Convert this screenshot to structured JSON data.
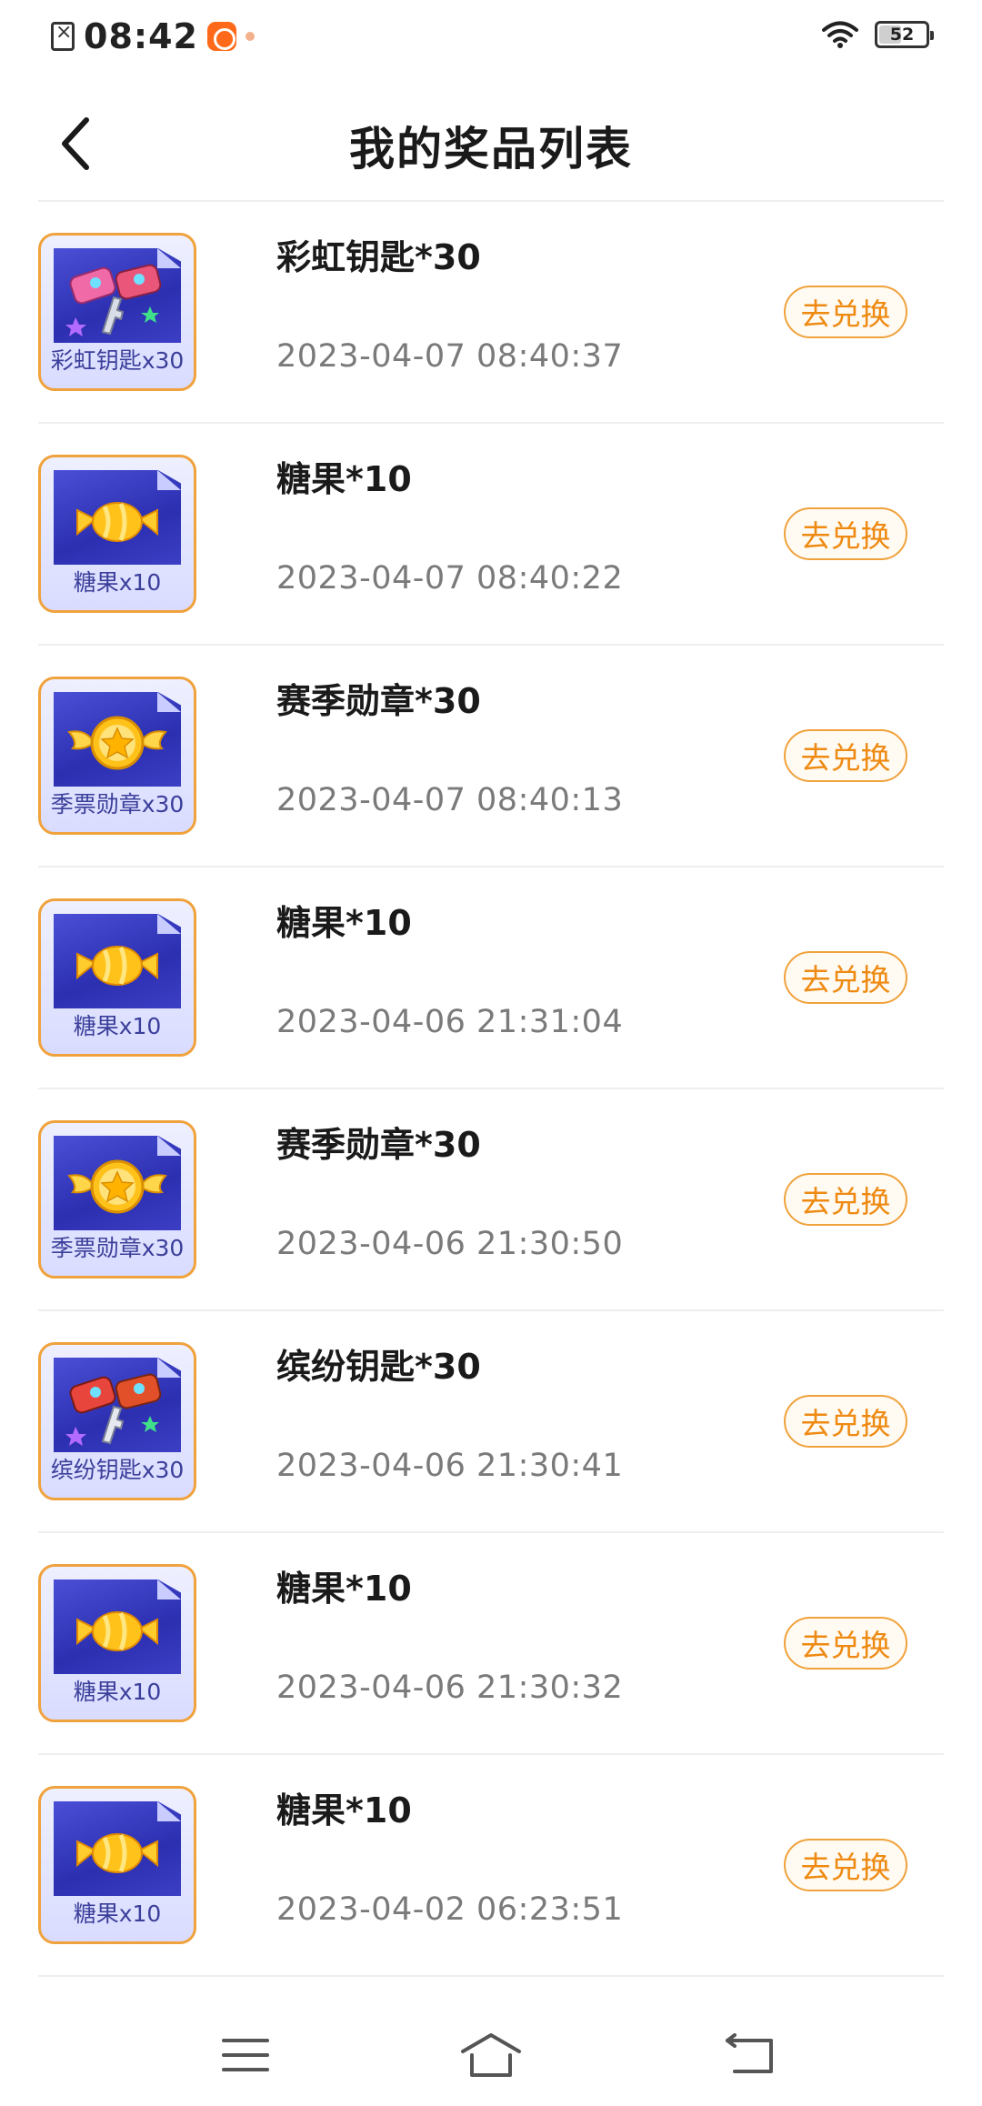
{
  "status_bar": {
    "time": "08:42",
    "battery_percent": "52",
    "battery_level": 0.52
  },
  "header": {
    "title": "我的奖品列表"
  },
  "colors": {
    "accent": "#ee8a12",
    "accent_border": "#f0a23c",
    "thumb_blue": "#2c2fb0",
    "divider": "#eeeeee",
    "date_gray": "#7a7a7a"
  },
  "prizes": [
    {
      "name": "彩虹钥匙*30",
      "date": "2023-04-07 08:40:37",
      "thumb_caption": "彩虹钥匙x30",
      "icon": "rainbow-key-icon",
      "action": "去兑换"
    },
    {
      "name": "糖果*10",
      "date": "2023-04-07 08:40:22",
      "thumb_caption": "糖果x10",
      "icon": "candy-icon",
      "action": "去兑换"
    },
    {
      "name": "赛季勋章*30",
      "date": "2023-04-07 08:40:13",
      "thumb_caption": "季票勋章x30",
      "icon": "medal-icon",
      "action": "去兑换"
    },
    {
      "name": "糖果*10",
      "date": "2023-04-06 21:31:04",
      "thumb_caption": "糖果x10",
      "icon": "candy-icon",
      "action": "去兑换"
    },
    {
      "name": "赛季勋章*30",
      "date": "2023-04-06 21:30:50",
      "thumb_caption": "季票勋章x30",
      "icon": "medal-icon",
      "action": "去兑换"
    },
    {
      "name": "缤纷钥匙*30",
      "date": "2023-04-06 21:30:41",
      "thumb_caption": "缤纷钥匙x30",
      "icon": "colorful-key-icon",
      "action": "去兑换"
    },
    {
      "name": "糖果*10",
      "date": "2023-04-06 21:30:32",
      "thumb_caption": "糖果x10",
      "icon": "candy-icon",
      "action": "去兑换"
    },
    {
      "name": "糖果*10",
      "date": "2023-04-02 06:23:51",
      "thumb_caption": "糖果x10",
      "icon": "candy-icon",
      "action": "去兑换"
    }
  ],
  "nav_bar": {
    "menu_icon": "menu-icon",
    "home_icon": "home-icon",
    "back_icon": "return-icon"
  }
}
